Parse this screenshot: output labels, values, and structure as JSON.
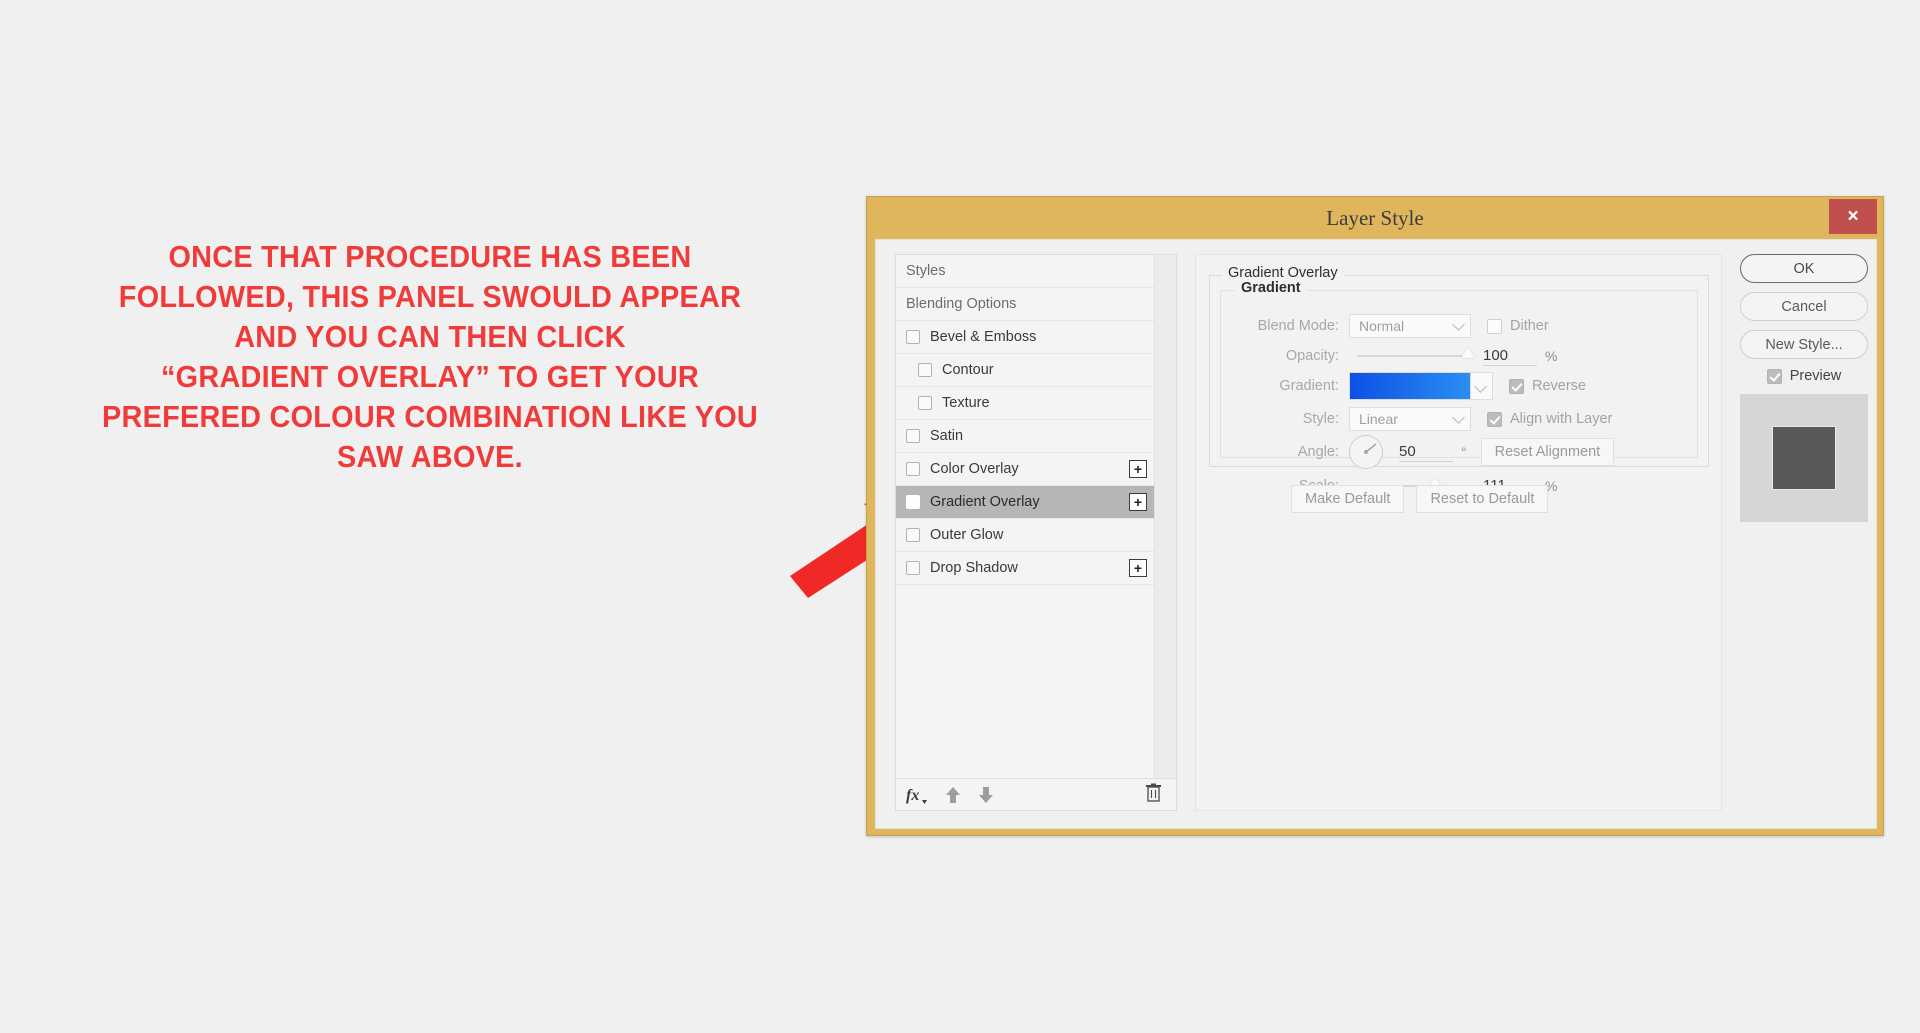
{
  "annotation": {
    "text": "ONCE THAT PROCEDURE HAS BEEN\nFOLLOWED, THIS PANEL SWOULD APPEAR\nAND YOU CAN THEN CLICK\n“GRADIENT OVERLAY” TO GET YOUR\nPREFERED COLOUR COMBINATION LIKE YOU\nSAW ABOVE.",
    "color": "#ef3b39",
    "arrow_color": "#ef2a26"
  },
  "dialog": {
    "title": "Layer Style",
    "frame_color": "#dfb65c",
    "close_label": "×",
    "close_color": "#c0504d"
  },
  "styles_panel": {
    "items": [
      {
        "label": "Styles",
        "type": "header",
        "checkbox": false,
        "checked": false,
        "selected": false,
        "indent": false,
        "plus": false
      },
      {
        "label": "Blending Options",
        "type": "header",
        "checkbox": false,
        "checked": false,
        "selected": false,
        "indent": false,
        "plus": false
      },
      {
        "label": "Bevel & Emboss",
        "type": "effect",
        "checkbox": true,
        "checked": false,
        "selected": false,
        "indent": false,
        "plus": false
      },
      {
        "label": "Contour",
        "type": "effect",
        "checkbox": true,
        "checked": false,
        "selected": false,
        "indent": true,
        "plus": false
      },
      {
        "label": "Texture",
        "type": "effect",
        "checkbox": true,
        "checked": false,
        "selected": false,
        "indent": true,
        "plus": false
      },
      {
        "label": "Satin",
        "type": "effect",
        "checkbox": true,
        "checked": false,
        "selected": false,
        "indent": false,
        "plus": false
      },
      {
        "label": "Color Overlay",
        "type": "effect",
        "checkbox": true,
        "checked": false,
        "selected": false,
        "indent": false,
        "plus": true
      },
      {
        "label": "Gradient Overlay",
        "type": "effect",
        "checkbox": true,
        "checked": false,
        "selected": true,
        "indent": false,
        "plus": true
      },
      {
        "label": "Outer Glow",
        "type": "effect",
        "checkbox": true,
        "checked": false,
        "selected": false,
        "indent": false,
        "plus": false
      },
      {
        "label": "Drop Shadow",
        "type": "effect",
        "checkbox": true,
        "checked": false,
        "selected": false,
        "indent": false,
        "plus": true
      }
    ],
    "plus_label": "+",
    "toolbar": {
      "fx_label": "fx",
      "icons": [
        "fx-icon",
        "move-up-icon",
        "move-down-icon",
        "trash-icon"
      ]
    }
  },
  "settings": {
    "group_label": "Gradient Overlay",
    "subgroup_label": "Gradient",
    "blend_mode": {
      "label": "Blend Mode:",
      "value": "Normal"
    },
    "dither": {
      "label": "Dither",
      "checked": false
    },
    "opacity": {
      "label": "Opacity:",
      "value": "100",
      "unit": "%",
      "slider_percent": 100
    },
    "gradient": {
      "label": "Gradient:",
      "start_color": "#0e50e6",
      "end_color": "#2a8ef1"
    },
    "reverse": {
      "label": "Reverse",
      "checked": true
    },
    "style": {
      "label": "Style:",
      "value": "Linear"
    },
    "align_with_layer": {
      "label": "Align with Layer",
      "checked": true
    },
    "angle": {
      "label": "Angle:",
      "value": "50",
      "unit": "°"
    },
    "reset_alignment_label": "Reset Alignment",
    "scale": {
      "label": "Scale:",
      "value": "111",
      "unit": "%",
      "slider_percent": 70
    },
    "make_default_label": "Make Default",
    "reset_to_default_label": "Reset to Default"
  },
  "right_column": {
    "ok_label": "OK",
    "cancel_label": "Cancel",
    "new_style_label": "New Style...",
    "preview": {
      "label": "Preview",
      "checked": true
    },
    "thumbnail": {
      "background": "#d6d6d6",
      "square_color": "#585858"
    }
  }
}
